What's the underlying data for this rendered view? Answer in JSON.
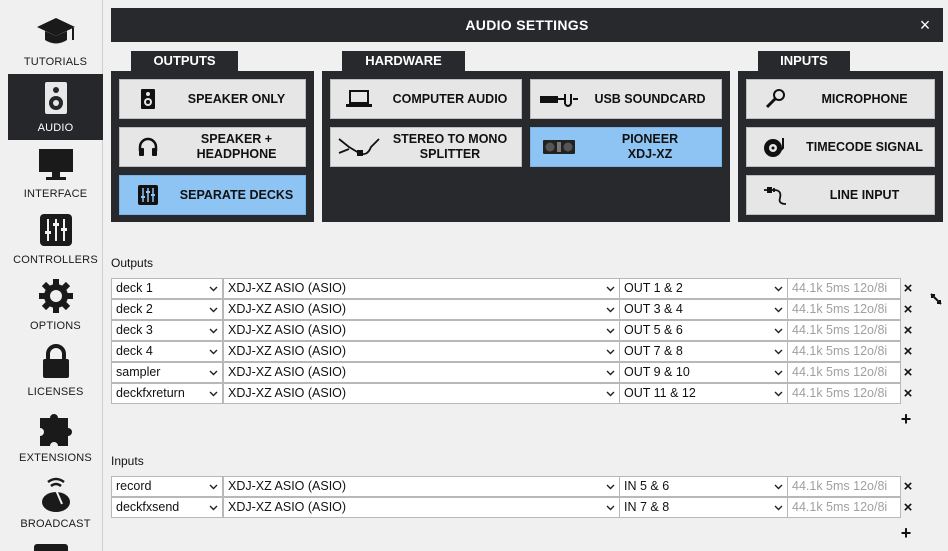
{
  "sidebar": {
    "items": [
      {
        "label": "TUTORIALS",
        "icon": "graduation-cap-icon"
      },
      {
        "label": "AUDIO",
        "icon": "speaker-icon",
        "active": true
      },
      {
        "label": "INTERFACE",
        "icon": "monitor-icon"
      },
      {
        "label": "CONTROLLERS",
        "icon": "mixer-sliders-icon"
      },
      {
        "label": "OPTIONS",
        "icon": "gear-icon"
      },
      {
        "label": "LICENSES",
        "icon": "lock-icon"
      },
      {
        "label": "EXTENSIONS",
        "icon": "puzzle-icon"
      },
      {
        "label": "BROADCAST",
        "icon": "broadcast-icon"
      }
    ]
  },
  "window": {
    "title": "AUDIO SETTINGS",
    "close": "×"
  },
  "groups": {
    "outputs": {
      "tab": "OUTPUTS",
      "buttons": [
        {
          "label": "SPEAKER ONLY",
          "icon": "speaker-icon",
          "selected": false
        },
        {
          "label": "SPEAKER +\nHEADPHONE",
          "icon": "headphone-icon",
          "selected": false
        },
        {
          "label": "SEPARATE DECKS",
          "icon": "mixer-icon",
          "selected": true
        }
      ]
    },
    "hardware": {
      "tab": "HARDWARE",
      "buttons": [
        {
          "label": "COMPUTER AUDIO",
          "icon": "laptop-icon",
          "selected": false
        },
        {
          "label": "USB SOUNDCARD",
          "icon": "usb-soundcard-icon",
          "selected": false
        },
        {
          "label": "STEREO TO MONO\nSPLITTER",
          "icon": "splitter-cable-icon",
          "selected": false
        },
        {
          "label": "PIONEER\nXDJ-XZ",
          "icon": "controller-device-icon",
          "selected": true
        }
      ]
    },
    "inputs": {
      "tab": "INPUTS",
      "buttons": [
        {
          "label": "MICROPHONE",
          "icon": "microphone-icon",
          "selected": false
        },
        {
          "label": "TIMECODE SIGNAL",
          "icon": "turntable-icon",
          "selected": false
        },
        {
          "label": "LINE INPUT",
          "icon": "rca-cable-icon",
          "selected": false
        }
      ]
    }
  },
  "outputs_table": {
    "label": "Outputs",
    "rows": [
      {
        "channel": "deck 1",
        "device": "XDJ-XZ ASIO (ASIO)",
        "port": "OUT 1 & 2",
        "info": "44.1k 5ms 12o/8i"
      },
      {
        "channel": "deck 2",
        "device": "XDJ-XZ ASIO (ASIO)",
        "port": "OUT 3 & 4",
        "info": "44.1k 5ms 12o/8i"
      },
      {
        "channel": "deck 3",
        "device": "XDJ-XZ ASIO (ASIO)",
        "port": "OUT 5 & 6",
        "info": "44.1k 5ms 12o/8i"
      },
      {
        "channel": "deck 4",
        "device": "XDJ-XZ ASIO (ASIO)",
        "port": "OUT 7 & 8",
        "info": "44.1k 5ms 12o/8i"
      },
      {
        "channel": "sampler",
        "device": "XDJ-XZ ASIO (ASIO)",
        "port": "OUT 9 & 10",
        "info": "44.1k 5ms 12o/8i"
      },
      {
        "channel": "deckfxreturn",
        "device": "XDJ-XZ ASIO (ASIO)",
        "port": "OUT 11 & 12",
        "info": "44.1k 5ms 12o/8i"
      }
    ]
  },
  "inputs_table": {
    "label": "Inputs",
    "rows": [
      {
        "channel": "record",
        "device": "XDJ-XZ ASIO (ASIO)",
        "port": "IN 5 & 6",
        "info": "44.1k 5ms 12o/8i"
      },
      {
        "channel": "deckfxsend",
        "device": "XDJ-XZ ASIO (ASIO)",
        "port": "IN 7 & 8",
        "info": "44.1k 5ms 12o/8i"
      }
    ]
  },
  "glyphs": {
    "remove": "×",
    "add": "+",
    "chevron": "⌄"
  },
  "colors": {
    "dark": "#28292c",
    "selected": "#8ec4f4",
    "button": "#e6e6e6"
  }
}
